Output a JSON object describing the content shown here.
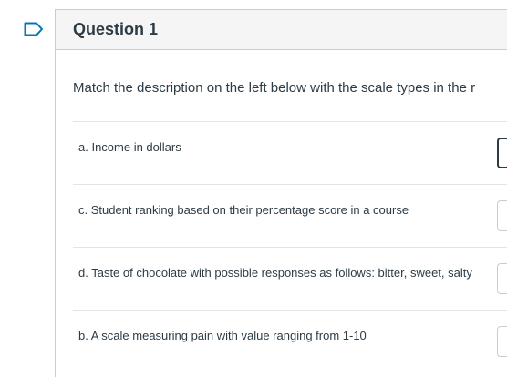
{
  "question": {
    "title": "Question 1",
    "prompt": "Match the description on the left below with the scale types in the r",
    "rows": [
      {
        "label": "a. Income in dollars"
      },
      {
        "label": "c. Student ranking based on their percentage score in a course"
      },
      {
        "label": "d. Taste of chocolate with possible responses as follows: bitter, sweet, salty"
      },
      {
        "label": "b. A scale measuring pain with value ranging from 1-10"
      }
    ]
  }
}
